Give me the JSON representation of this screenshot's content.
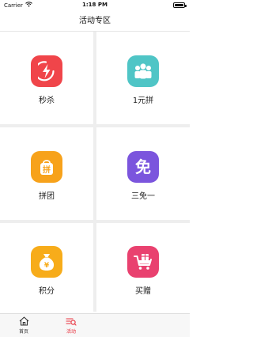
{
  "status_bar": {
    "carrier": "Carrier",
    "time": "1:18 PM"
  },
  "nav": {
    "title": "活动专区"
  },
  "grid": [
    {
      "label": "秒杀",
      "icon": "lightning-icon",
      "color": "#f0454a"
    },
    {
      "label": "1元拼",
      "icon": "group-people-icon",
      "color": "#4fc5c6"
    },
    {
      "label": "拼团",
      "icon": "shopping-bag-icon",
      "glyph": "拼",
      "color": "#f7a21b"
    },
    {
      "label": "三免一",
      "icon": "free-icon",
      "glyph": "免",
      "color": "#7b55dd"
    },
    {
      "label": "积分",
      "icon": "money-bag-icon",
      "glyph": "¥",
      "color": "#f7ac1a"
    },
    {
      "label": "买赠",
      "icon": "cart-gift-icon",
      "color": "#e9416f"
    }
  ],
  "tab_bar": {
    "items": [
      {
        "label": "首页",
        "icon": "home-icon",
        "active": false
      },
      {
        "label": "活动",
        "icon": "activity-icon",
        "active": true
      }
    ],
    "active_color": "#e8303c"
  }
}
